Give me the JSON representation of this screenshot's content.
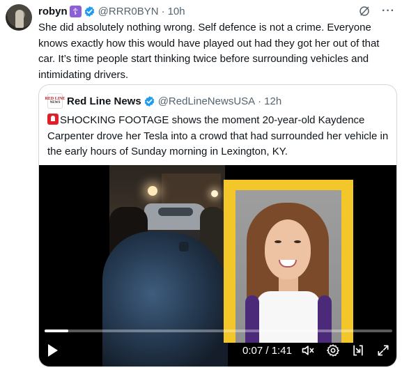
{
  "tweet": {
    "author_name": "robyn",
    "author_handle": "@RRR0BYN",
    "separator": "·",
    "time": "10h",
    "text": "She did absolutely nothing wrong. Self defence is not a crime. Everyone knows exactly how this would have played out had they got her out of that car. It’s time people start thinking twice before surrounding vehicles and intimidating drivers.",
    "cross_badge": "☦",
    "more_label": "···"
  },
  "quote": {
    "avatar_line1": "RED LINE",
    "avatar_line2": "NEWS",
    "author_name": "Red Line News",
    "author_handle": "@RedLineNewsUSA",
    "separator": "·",
    "time": "12h",
    "text": "SHOCKING FOOTAGE shows the moment 20-year-old Kaydence Carpenter drove her Tesla into a crowd that had surrounded her vehicle in the early hours of Sunday morning in Lexington, KY."
  },
  "video": {
    "current_time": "0:07",
    "duration": "1:41",
    "time_separator": " / ",
    "progress_fraction": 0.069
  },
  "colors": {
    "verified_blue": "#1d9bf0",
    "muted_text": "#536471",
    "border": "#cfd9de",
    "frame_yellow": "#f3c62a"
  },
  "icons": [
    "grok-icon",
    "more-icon",
    "verified-icon",
    "play-icon",
    "mute-icon",
    "settings-icon",
    "pip-icon",
    "fullscreen-icon"
  ]
}
